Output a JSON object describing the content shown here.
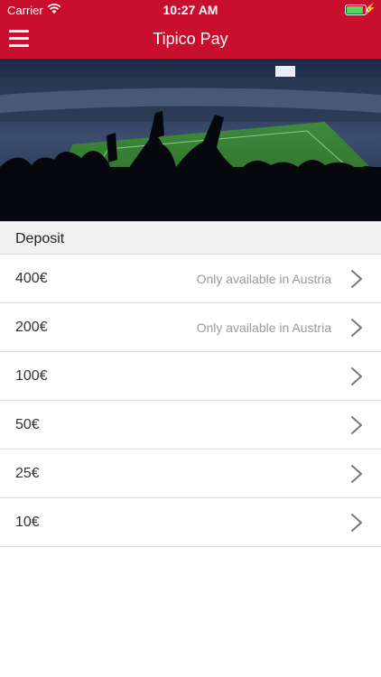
{
  "status_bar": {
    "carrier": "Carrier",
    "time": "10:27 AM",
    "battery_level": 0.9
  },
  "nav": {
    "title": "Tipico Pay",
    "menu_icon": "hamburger-icon"
  },
  "hero": {
    "image": "stadium-crowd-banner"
  },
  "deposit": {
    "header": "Deposit",
    "items": [
      {
        "amount": "400€",
        "note": "Only available in Austria"
      },
      {
        "amount": "200€",
        "note": "Only available in Austria"
      },
      {
        "amount": "100€",
        "note": ""
      },
      {
        "amount": "50€",
        "note": ""
      },
      {
        "amount": "25€",
        "note": ""
      },
      {
        "amount": "10€",
        "note": ""
      }
    ]
  },
  "colors": {
    "brand_red": "#c8102e",
    "battery_green": "#4cd964"
  }
}
